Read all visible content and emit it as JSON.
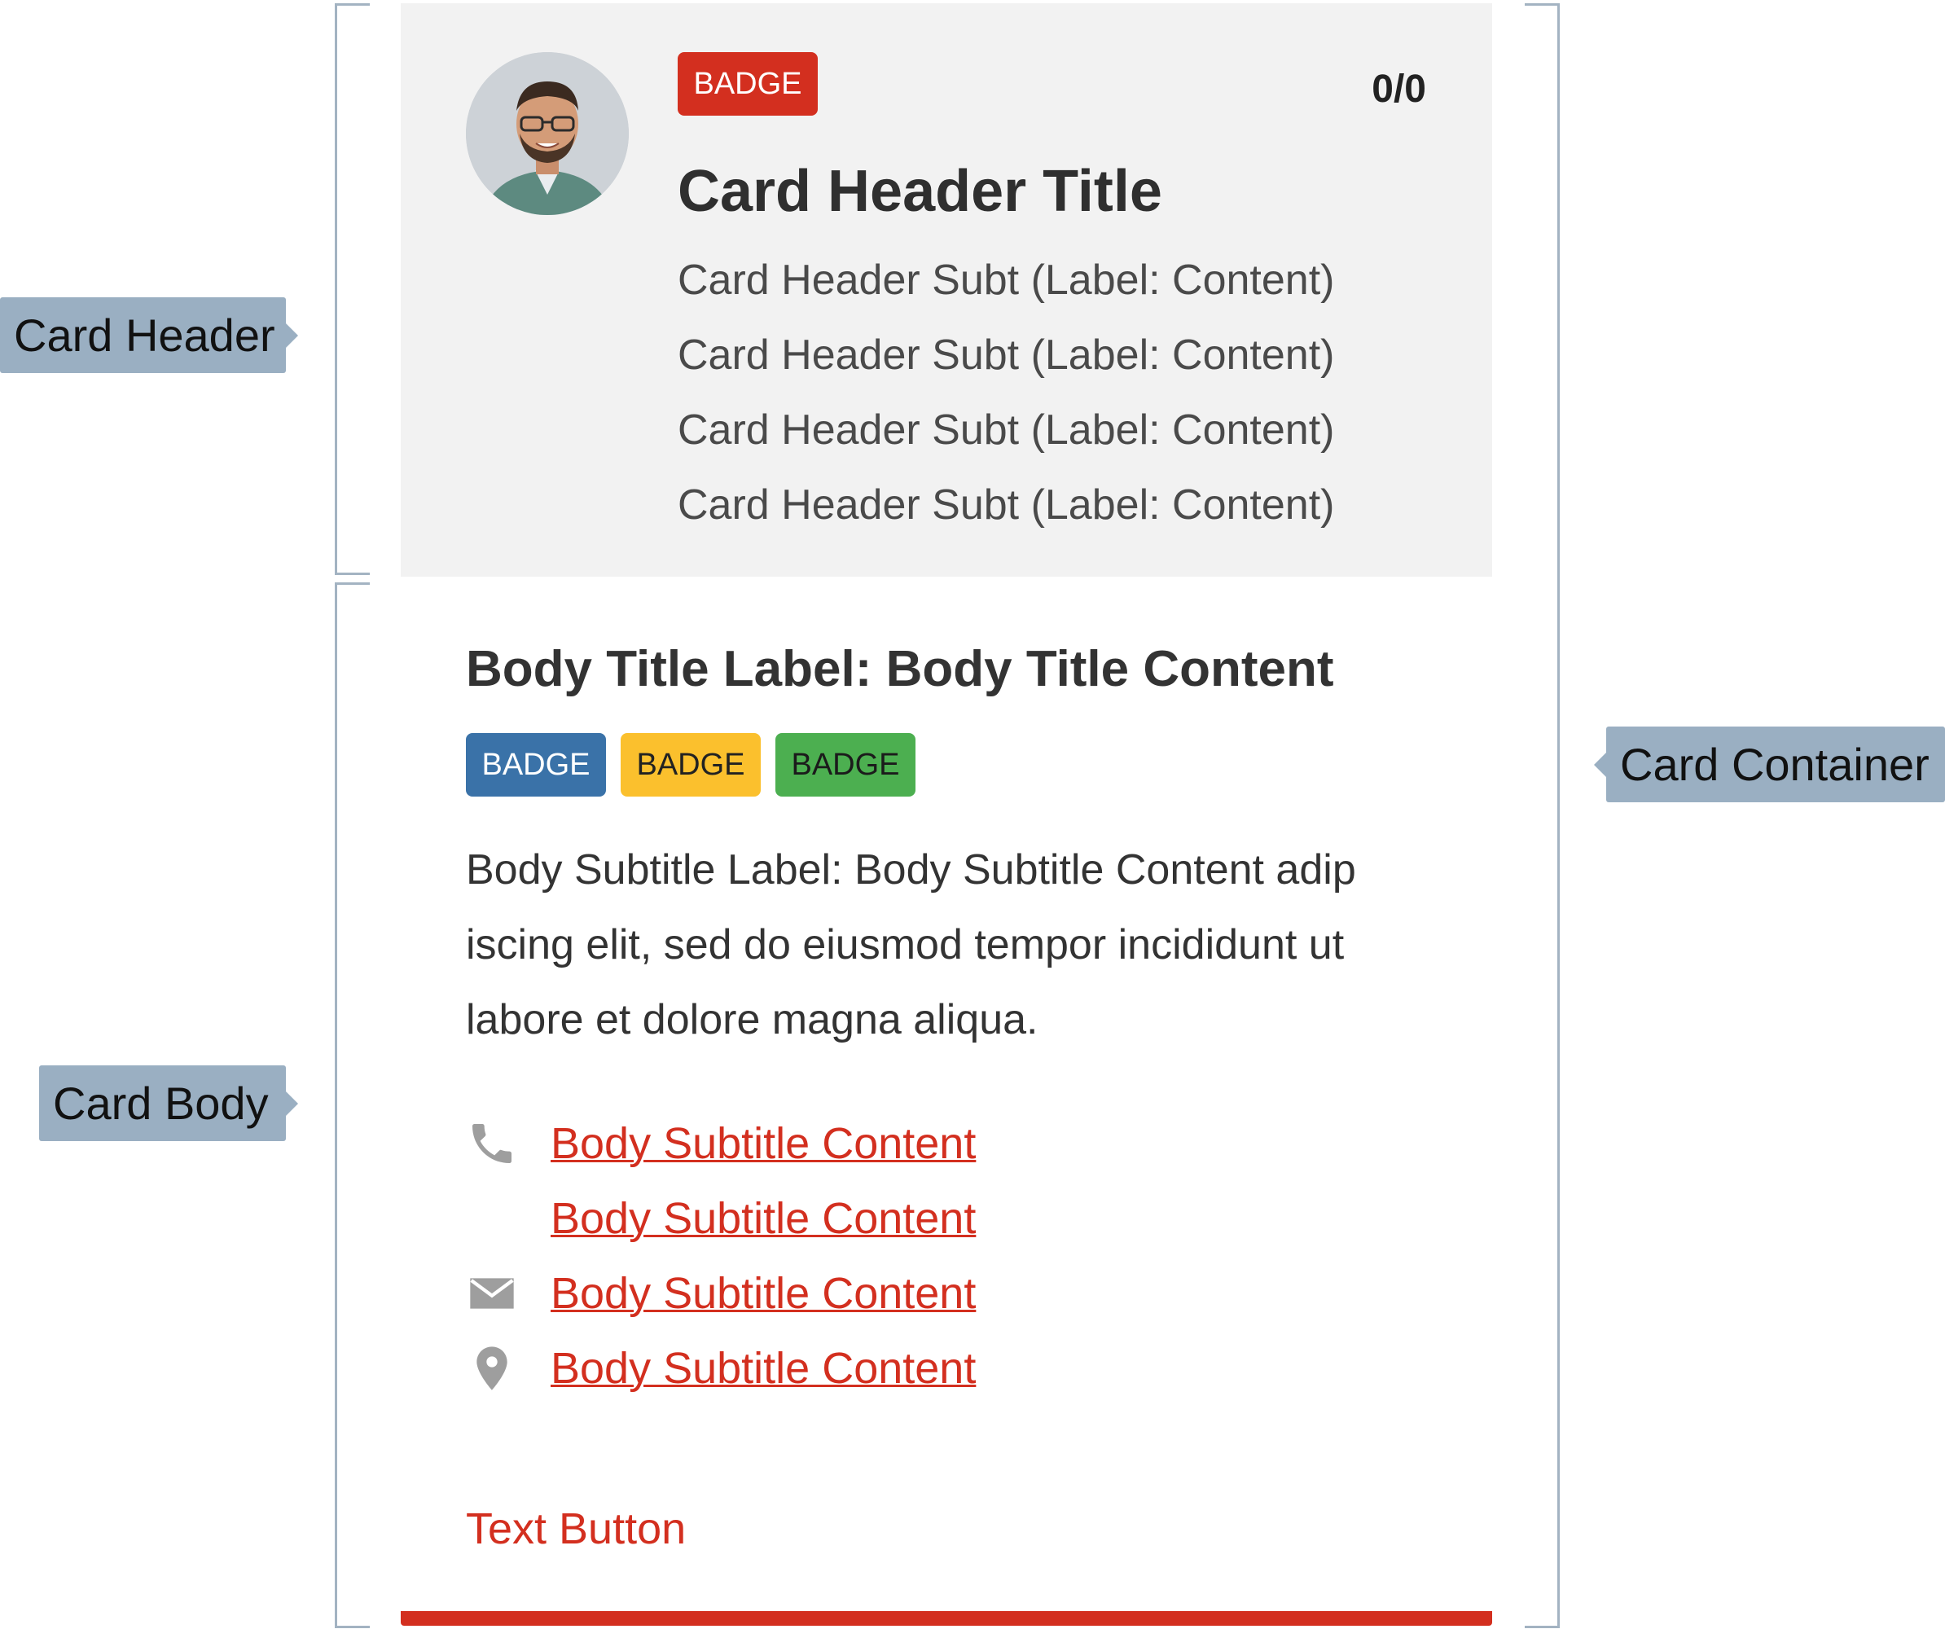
{
  "annotations": {
    "card_header": "Card Header",
    "card_body": "Card Body",
    "card_container": "Card Container"
  },
  "card": {
    "header": {
      "badge": "BADGE",
      "counter": "0/0",
      "title": "Card Header Title",
      "subtitles": [
        "Card Header Subt (Label: Content)",
        "Card Header Subt (Label: Content)",
        "Card Header Subt (Label: Content)",
        "Card Header Subt (Label: Content)"
      ]
    },
    "body": {
      "title": "Body Title Label: Body Title Content",
      "badges": [
        {
          "label": "BADGE",
          "color": "#3a72a8"
        },
        {
          "label": "BADGE",
          "color": "#fbc02d"
        },
        {
          "label": "BADGE",
          "color": "#4caf50"
        }
      ],
      "paragraph": "Body Subtitle Label: Body Subtitle Content adip iscing elit, sed do eiusmod tempor incididunt ut labore et dolore magna aliqua.",
      "contacts": [
        {
          "icon": "phone-icon",
          "text": "Body Subtitle Content"
        },
        {
          "icon": "",
          "text": "Body Subtitle Content"
        },
        {
          "icon": "mail-icon",
          "text": "Body Subtitle Content"
        },
        {
          "icon": "location-pin-icon",
          "text": "Body Subtitle Content"
        }
      ],
      "text_button": "Text Button"
    }
  },
  "colors": {
    "accent": "#d32f1f",
    "header_bg": "#f2f2f2",
    "annotation": "#9aafc2"
  }
}
